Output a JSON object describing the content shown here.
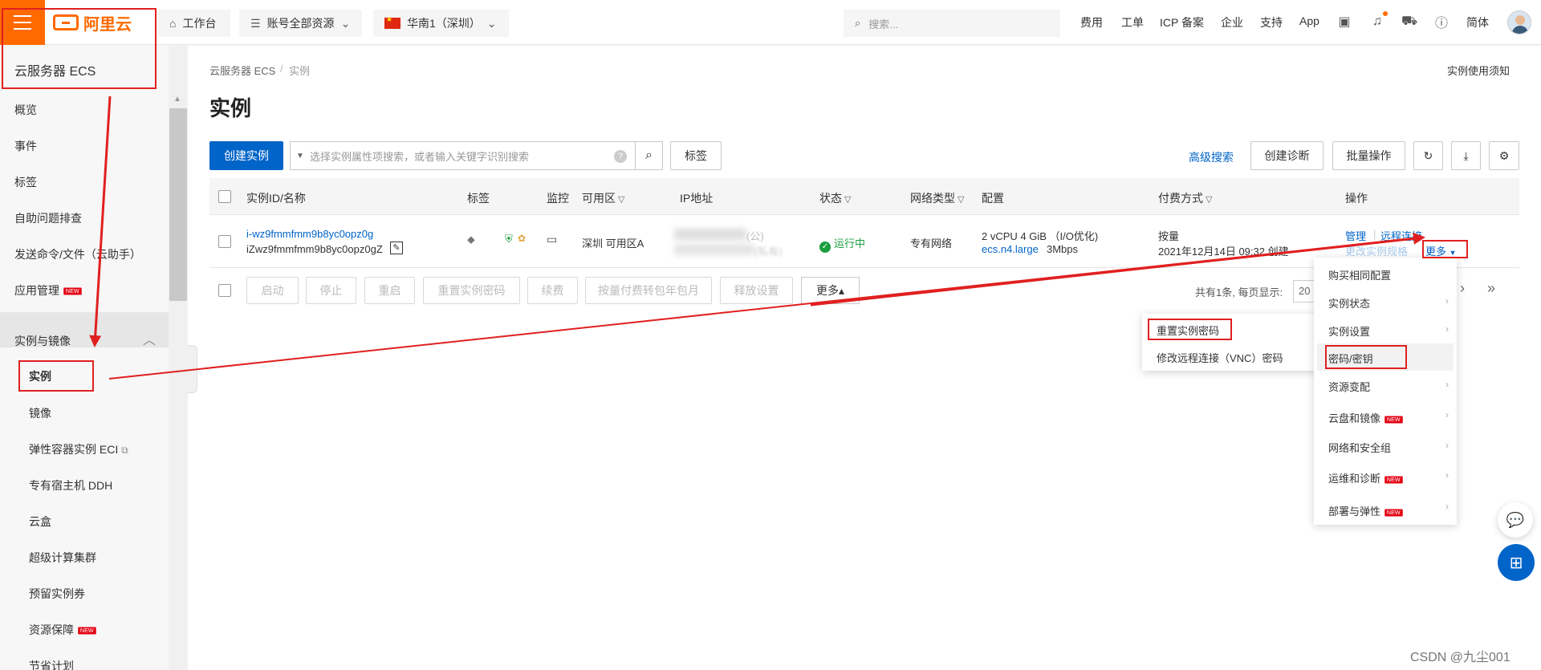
{
  "topbar": {
    "logo_text": "阿里云",
    "workbench": "工作台",
    "account_resources": "账号全部资源",
    "region": "华南1（深圳）",
    "search_placeholder": "搜索...",
    "nav": [
      "费用",
      "工单",
      "ICP 备案",
      "企业",
      "支持",
      "App"
    ],
    "language": "简体"
  },
  "sidebar": {
    "title": "云服务器 ECS",
    "items": [
      "概览",
      "事件",
      "标签",
      "自助问题排查",
      "发送命令/文件（云助手）",
      "应用管理"
    ],
    "app_mgmt_badge": "NEW",
    "group": "实例与镜像",
    "sub_items": [
      "实例",
      "镜像",
      "弹性容器实例 ECI",
      "专有宿主机 DDH",
      "云盒",
      "超级计算集群",
      "预留实例券",
      "资源保障",
      "节省计划"
    ],
    "resource_badge": "NEW"
  },
  "main": {
    "breadcrumb": [
      "云服务器 ECS",
      "/",
      "实例"
    ],
    "notice_link": "实例使用须知",
    "title": "实例",
    "create_button": "创建实例",
    "filter_placeholder": "选择实例属性项搜索，或者输入关键字识别搜索",
    "tag_button": "标签",
    "advanced_search": "高级搜索",
    "create_diagnosis": "创建诊断",
    "batch_ops": "批量操作"
  },
  "table": {
    "headers": [
      "实例ID/名称",
      "标签",
      "监控",
      "可用区",
      "IP地址",
      "状态",
      "网络类型",
      "配置",
      "付费方式",
      "操作"
    ],
    "row": {
      "instance_id": "i-wz9fmmfmm9b8yc0opz0g",
      "instance_name": "iZwz9fmmfmm9b8yc0opz0gZ",
      "zone": "深圳 可用区A",
      "ip_public": "(公)",
      "ip_private": "(私有)",
      "status": "运行中",
      "network": "专有网络",
      "config_line1": "2 vCPU 4 GiB （I/O优化)",
      "config_type": "ecs.n4.large",
      "config_bandwidth": "3Mbps",
      "billing": "按量",
      "created": "2021年12月14日 09:32 创建",
      "action_manage": "管理",
      "action_sep": "|",
      "action_remote": "远程连接",
      "action_change": "更改实例规格",
      "action_more": "更多"
    }
  },
  "bottom_toolbar": {
    "buttons": [
      "启动",
      "停止",
      "重启",
      "重置实例密码",
      "续费",
      "按量付费转包年包月",
      "释放设置"
    ],
    "more": "更多▴",
    "pager_text": "共有1条, 每页显示:",
    "page_size": "20",
    "next": "›",
    "last": "»"
  },
  "more_menu": {
    "items": [
      "购买相同配置",
      "实例状态",
      "实例设置",
      "密码/密钥",
      "资源变配",
      "云盘和镜像",
      "网络和安全组",
      "运维和诊断",
      "部署与弹性"
    ],
    "new_badge": "NEW"
  },
  "password_submenu": {
    "items": [
      "重置实例密码",
      "修改远程连接（VNC）密码"
    ]
  },
  "watermark": "CSDN @九尘001",
  "colors": {
    "brand": "#ff6a00",
    "primary": "#0064c8",
    "annotation": "#e02020",
    "running": "#1b9e3e"
  }
}
